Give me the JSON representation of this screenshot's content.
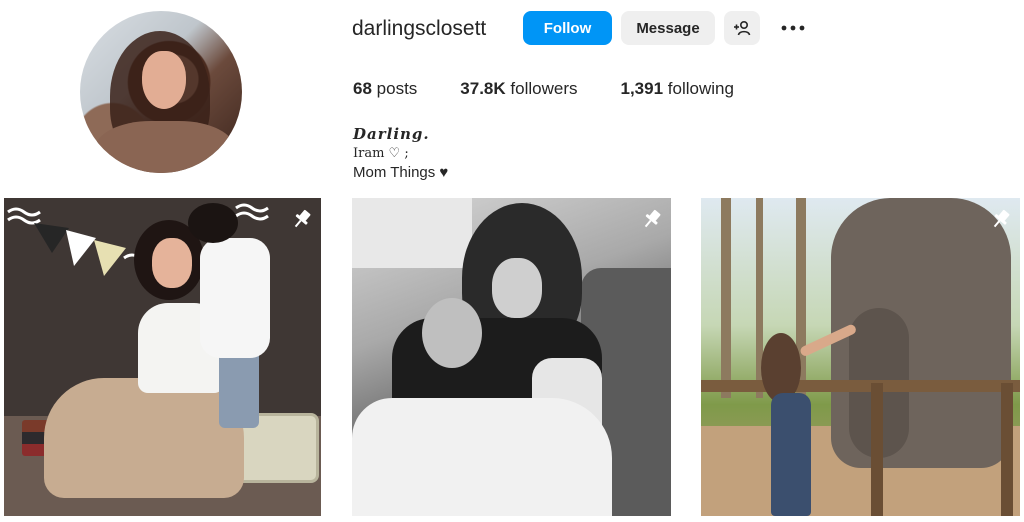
{
  "profile": {
    "username": "darlingsclosett",
    "avatar_alt": "profile-photo"
  },
  "actions": {
    "follow_label": "Follow",
    "message_label": "Message",
    "add_user_icon": "add-person-icon",
    "more_icon": "more-options-icon"
  },
  "stats": {
    "posts_count": "68",
    "posts_label": "posts",
    "followers_count": "37.8K",
    "followers_label": "followers",
    "following_count": "1,391",
    "following_label": "following"
  },
  "bio": {
    "name": "Darling.",
    "line2": "Iram ♡ ;",
    "line3": "Mom Things ♥"
  },
  "posts": [
    {
      "pinned": true,
      "icon": "pin-icon",
      "scene": "mother-and-child-studio"
    },
    {
      "pinned": true,
      "icon": "pin-icon",
      "scene": "mother-holding-newborn-bw"
    },
    {
      "pinned": true,
      "icon": "pin-icon",
      "scene": "woman-feeding-elephant"
    }
  ],
  "colors": {
    "accent": "#0095f6",
    "button_secondary": "#efefef",
    "text": "#262626"
  }
}
